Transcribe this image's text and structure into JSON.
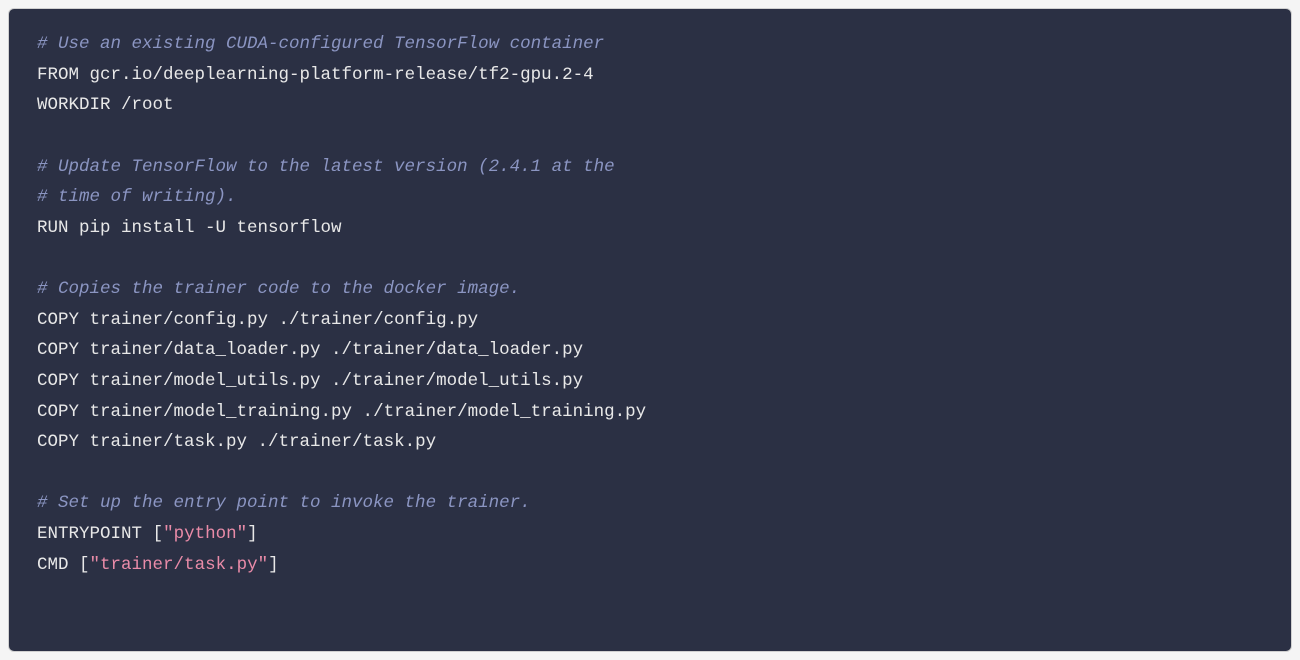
{
  "lines": [
    {
      "type": "comment",
      "text": "# Use an existing CUDA-configured TensorFlow container"
    },
    {
      "type": "plain",
      "segments": [
        {
          "cls": "keyword",
          "text": "FROM"
        },
        {
          "cls": "text",
          "text": " gcr.io/deeplearning-platform-release/tf2-gpu.2-4"
        }
      ]
    },
    {
      "type": "plain",
      "segments": [
        {
          "cls": "keyword",
          "text": "WORKDIR"
        },
        {
          "cls": "text",
          "text": " /root"
        }
      ]
    },
    {
      "type": "blank",
      "text": ""
    },
    {
      "type": "comment",
      "text": "# Update TensorFlow to the latest version (2.4.1 at the"
    },
    {
      "type": "comment",
      "text": "# time of writing)."
    },
    {
      "type": "plain",
      "segments": [
        {
          "cls": "keyword",
          "text": "RUN"
        },
        {
          "cls": "text",
          "text": " pip install -U tensorflow"
        }
      ]
    },
    {
      "type": "blank",
      "text": ""
    },
    {
      "type": "comment",
      "text": "# Copies the trainer code to the docker image."
    },
    {
      "type": "plain",
      "segments": [
        {
          "cls": "keyword",
          "text": "COPY"
        },
        {
          "cls": "text",
          "text": " trainer/config.py ./trainer/config.py"
        }
      ]
    },
    {
      "type": "plain",
      "segments": [
        {
          "cls": "keyword",
          "text": "COPY"
        },
        {
          "cls": "text",
          "text": " trainer/data_loader.py ./trainer/data_loader.py"
        }
      ]
    },
    {
      "type": "plain",
      "segments": [
        {
          "cls": "keyword",
          "text": "COPY"
        },
        {
          "cls": "text",
          "text": " trainer/model_utils.py ./trainer/model_utils.py"
        }
      ]
    },
    {
      "type": "plain",
      "segments": [
        {
          "cls": "keyword",
          "text": "COPY"
        },
        {
          "cls": "text",
          "text": " trainer/model_training.py ./trainer/model_training.py"
        }
      ]
    },
    {
      "type": "plain",
      "segments": [
        {
          "cls": "keyword",
          "text": "COPY"
        },
        {
          "cls": "text",
          "text": " trainer/task.py ./trainer/task.py"
        }
      ]
    },
    {
      "type": "blank",
      "text": ""
    },
    {
      "type": "comment",
      "text": "# Set up the entry point to invoke the trainer."
    },
    {
      "type": "plain",
      "segments": [
        {
          "cls": "keyword",
          "text": "ENTRYPOINT"
        },
        {
          "cls": "text",
          "text": " "
        },
        {
          "cls": "bracket",
          "text": "["
        },
        {
          "cls": "string",
          "text": "\"python\""
        },
        {
          "cls": "bracket",
          "text": "]"
        }
      ]
    },
    {
      "type": "plain",
      "segments": [
        {
          "cls": "keyword",
          "text": "CMD"
        },
        {
          "cls": "text",
          "text": " "
        },
        {
          "cls": "bracket",
          "text": "["
        },
        {
          "cls": "string",
          "text": "\"trainer/task.py\""
        },
        {
          "cls": "bracket",
          "text": "]"
        }
      ]
    }
  ]
}
